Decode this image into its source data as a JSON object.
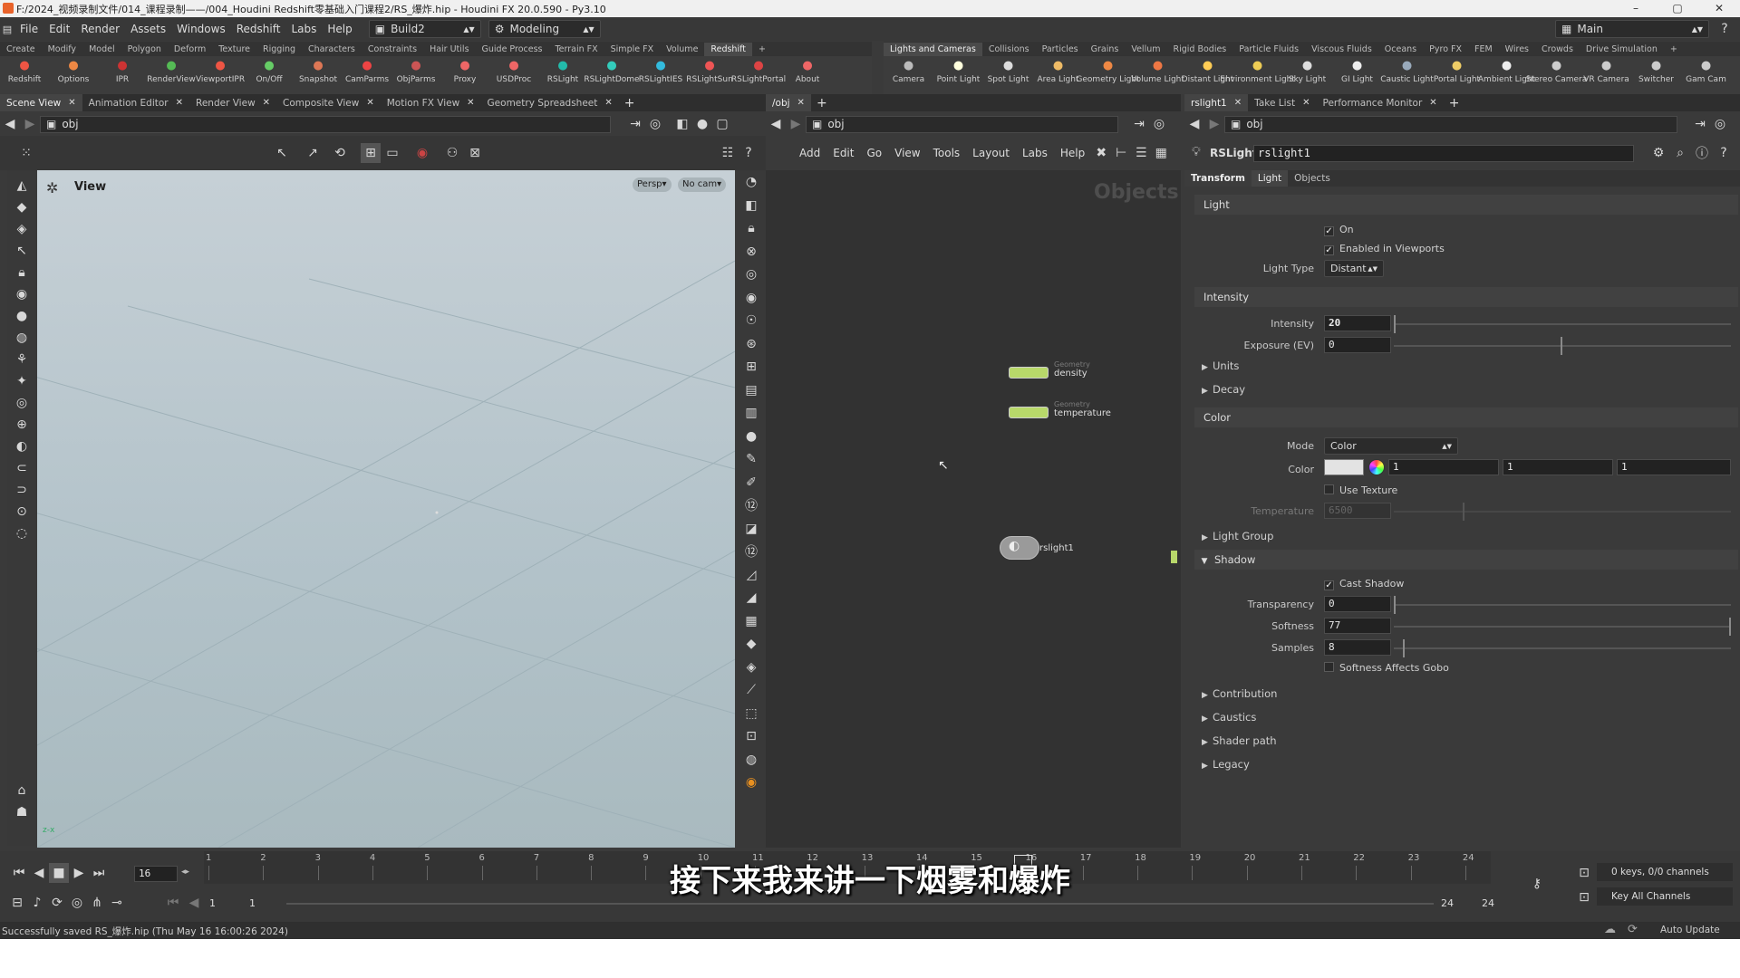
{
  "window": {
    "title": "F:/2024_视频录制文件/014_课程录制——/004_Houdini Redshift零基础入门课程2/RS_爆炸.hip - Houdini FX 20.0.590 - Py3.10",
    "controls": [
      "–",
      "▢",
      "✕"
    ]
  },
  "menubar": {
    "items": [
      "File",
      "Edit",
      "Render",
      "Assets",
      "Windows",
      "Redshift",
      "Labs",
      "Help"
    ],
    "build": "Build2",
    "desktop": "Modeling",
    "workspace": "Main"
  },
  "shelf_left": {
    "tabs": [
      "Create",
      "Modify",
      "Model",
      "Polygon",
      "Deform",
      "Texture",
      "Rigging",
      "Characters",
      "Constraints",
      "Hair Utils",
      "Guide Process",
      "Terrain FX",
      "Simple FX",
      "Volume",
      "Redshift"
    ],
    "active_tab": "Redshift",
    "tools": [
      "Redshift",
      "Options",
      "IPR",
      "RenderView",
      "ViewportIPR",
      "On/Off",
      "Snapshot",
      "CamParms",
      "ObjParms",
      "Proxy",
      "USDProc",
      "RSLight",
      "RSLightDome",
      "RSLightIES",
      "RSLightSun",
      "RSLightPortal",
      "About"
    ]
  },
  "shelf_right": {
    "tabs": [
      "Lights and Cameras",
      "Collisions",
      "Particles",
      "Grains",
      "Vellum",
      "Rigid Bodies",
      "Particle Fluids",
      "Viscous Fluids",
      "Oceans",
      "Pyro FX",
      "FEM",
      "Wires",
      "Crowds",
      "Drive Simulation"
    ],
    "active_tab": "Lights and Cameras",
    "tools": [
      "Camera",
      "Point Light",
      "Spot Light",
      "Area Light",
      "Geometry Light",
      "Volume Light",
      "Distant Light",
      "Environment Light",
      "Sky Light",
      "GI Light",
      "Caustic Light",
      "Portal Light",
      "Ambient Light",
      "Stereo Camera",
      "VR Camera",
      "Switcher",
      "Gam Cam"
    ]
  },
  "left_pane": {
    "tabs": [
      "Scene View",
      "Animation Editor",
      "Render View",
      "Composite View",
      "Motion FX View",
      "Geometry Spreadsheet"
    ],
    "path": "obj",
    "viewport_label": "View",
    "persp": "Persp",
    "cam": "No cam"
  },
  "network_pane": {
    "tab": "/obj",
    "path": "obj",
    "menu": [
      "Add",
      "Edit",
      "Go",
      "View",
      "Tools",
      "Layout",
      "Labs",
      "Help"
    ],
    "context_label": "Objects",
    "nodes": [
      {
        "category": "Geometry",
        "name": "density"
      },
      {
        "category": "Geometry",
        "name": "temperature"
      },
      {
        "category": "",
        "name": "rslight1"
      }
    ]
  },
  "params_pane": {
    "tabs": [
      "rslight1",
      "Take List",
      "Performance Monitor"
    ],
    "path": "obj",
    "node_type": "RSLight",
    "node_name": "rslight1",
    "subtabs": [
      "Transform",
      "Light",
      "Objects"
    ],
    "active_subtab": "Light",
    "light": {
      "section": "Light",
      "on_label": "On",
      "enabled_label": "Enabled in Viewports",
      "type_label": "Light Type",
      "type_value": "Distant"
    },
    "intensity": {
      "section": "Intensity",
      "intensity_label": "Intensity",
      "intensity_value": "20",
      "exposure_label": "Exposure (EV)",
      "exposure_value": "0",
      "units": "Units",
      "decay": "Decay"
    },
    "color": {
      "section": "Color",
      "mode_label": "Mode",
      "mode_value": "Color",
      "color_label": "Color",
      "r": "1",
      "g": "1",
      "b": "1",
      "use_texture": "Use Texture",
      "temperature_label": "Temperature",
      "temperature_value": "6500"
    },
    "light_group": "Light Group",
    "shadow": {
      "section": "Shadow",
      "cast_label": "Cast Shadow",
      "transparency_label": "Transparency",
      "transparency_value": "0",
      "softness_label": "Softness",
      "softness_value": "77",
      "samples_label": "Samples",
      "samples_value": "8",
      "gobo_label": "Softness Affects Gobo"
    },
    "folds": [
      "Contribution",
      "Caustics",
      "Shader path",
      "Legacy"
    ]
  },
  "timeline": {
    "frame": "16",
    "ticks": [
      "1",
      "2",
      "3",
      "4",
      "5",
      "6",
      "7",
      "8",
      "9",
      "10",
      "11",
      "12",
      "13",
      "14",
      "15",
      "16",
      "17",
      "18",
      "19",
      "20",
      "21",
      "22",
      "23",
      "24"
    ],
    "range_start": "1",
    "range_start2": "1",
    "range_end": "24",
    "range_end2": "24",
    "keys": "0 keys, 0/0 channels",
    "key_all": "Key All Channels",
    "auto_update": "Auto Update"
  },
  "status": "Successfully saved RS_爆炸.hip (Thu May 16 16:00:26 2024)",
  "subtitle": "接下来我来讲一下烟雾和爆炸"
}
